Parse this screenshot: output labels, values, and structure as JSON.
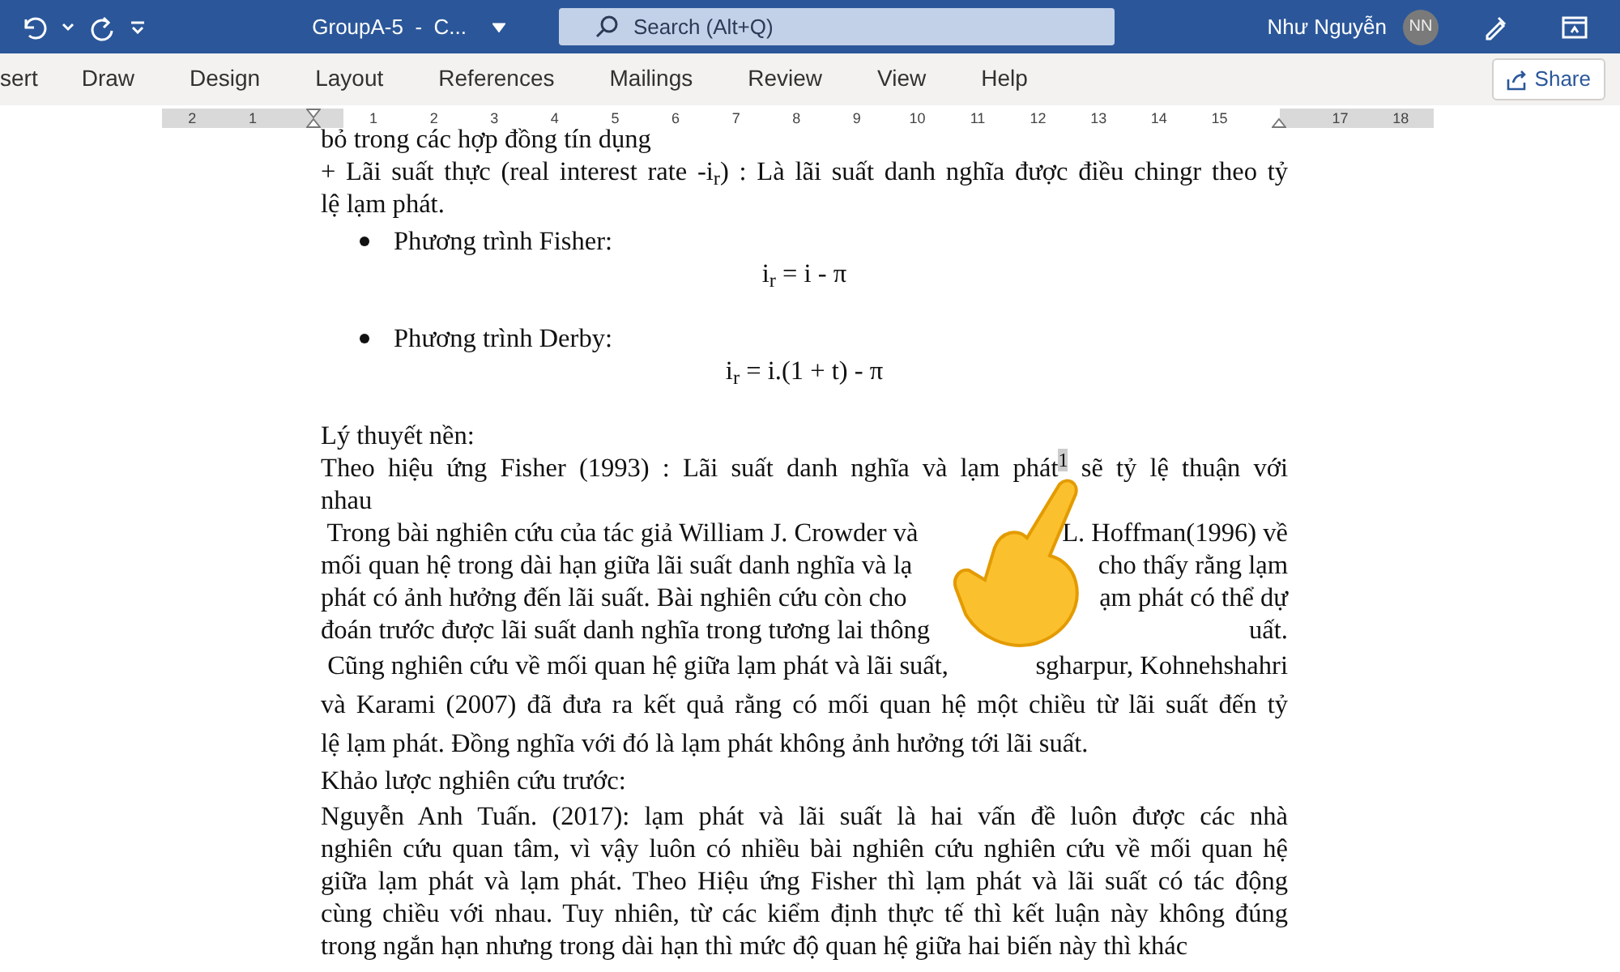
{
  "title_bar": {
    "document_title": "GroupA-5  -  C...",
    "search_placeholder": "Search (Alt+Q)",
    "user_name": "Như Nguyễn",
    "user_initials": "NN"
  },
  "ribbon": {
    "tabs": [
      {
        "label": "sert",
        "selected": false
      },
      {
        "label": "Draw",
        "selected": false
      },
      {
        "label": "Design",
        "selected": false
      },
      {
        "label": "Layout",
        "selected": false
      },
      {
        "label": "References",
        "selected": false
      },
      {
        "label": "Mailings",
        "selected": false
      },
      {
        "label": "Review",
        "selected": false
      },
      {
        "label": "View",
        "selected": false
      },
      {
        "label": "Help",
        "selected": false
      }
    ],
    "share_label": "Share"
  },
  "ruler": {
    "left_numbers": [
      "2",
      "1"
    ],
    "numbers": [
      "1",
      "2",
      "3",
      "4",
      "5",
      "6",
      "7",
      "8",
      "9",
      "10",
      "11",
      "12",
      "13",
      "14",
      "15"
    ],
    "right_numbers": [
      "17",
      "18"
    ]
  },
  "document": {
    "blocks": [
      {
        "kind": "paragraph",
        "lines": [
          {
            "text": "bỏ trong các hợp đồng tín dụng"
          }
        ]
      },
      {
        "kind": "paragraph",
        "lines": [
          {
            "text": "+ Lãi suất thực (real interest rate -i$_{r}$) : Là lãi suất danh nghĩa được điều chingr theo tỷ"
          },
          {
            "text": "lệ lạm phát."
          }
        ]
      },
      {
        "kind": "bullet",
        "lines": [
          {
            "text": "Phương trình Fisher:"
          }
        ]
      },
      {
        "kind": "formula",
        "lines": [
          {
            "text": "i$_{r}$ = i - π"
          }
        ]
      },
      {
        "kind": "bullet",
        "lines": [
          {
            "text": "Phương trình Derby:"
          }
        ]
      },
      {
        "kind": "formula",
        "lines": [
          {
            "text": "i$_{r}$ = i.(1 + t) - π"
          }
        ]
      },
      {
        "kind": "heading",
        "lines": [
          {
            "text": "Lý thuyết nền:"
          }
        ]
      },
      {
        "kind": "paragraph",
        "lines": [
          {
            "text": " Theo hiệu ứng Fisher (1993) : Lãi suất danh nghĩa và lạm phát$^{1}$ sẽ tỷ lệ thuận với"
          },
          {
            "text": "nhau"
          }
        ]
      },
      {
        "kind": "paragraph",
        "lines": [
          {
            "parts": [
              " Trong bài nghiên cứu của tác giả William J. Crowder và",
              "L. Hoffman(1996) về"
            ]
          },
          {
            "parts": [
              "mối quan hệ trong dài hạn giữa lãi suất danh nghĩa và lạ",
              "cho thấy rằng lạm"
            ]
          },
          {
            "parts": [
              "phát có ảnh hưởng đến lãi suất. Bài nghiên cứu còn cho",
              "ạm phát có thể dự"
            ]
          },
          {
            "parts": [
              "đoán trước được lãi suất danh nghĩa trong tương lai thông",
              "uất."
            ]
          }
        ]
      },
      {
        "kind": "paragraph-spaced",
        "lines": [
          {
            "parts": [
              " Cũng nghiên cứu về mối quan hệ giữa lạm phát và lãi suất,",
              "sgharpur, Kohnehshahri"
            ]
          },
          {
            "text": "và Karami (2007) đã đưa ra kết quả rằng có mối quan hệ một chiều từ lãi suất đến tỷ"
          },
          {
            "text": "lệ lạm phát. Đồng nghĩa với đó là lạm phát không ảnh hưởng tới lãi suất."
          }
        ]
      },
      {
        "kind": "heading-spaced",
        "lines": [
          {
            "text": "Khảo lược nghiên cứu trước:"
          }
        ]
      },
      {
        "kind": "paragraph-spaced-top",
        "lines": [
          {
            "text": "Nguyễn Anh Tuấn. (2017): lạm phát và lãi suất là hai vấn đề luôn được các nhà"
          },
          {
            "text": "nghiên cứu quan tâm, vì vậy luôn có nhiều bài nghiên cứu nghiên cứu về mối quan hệ"
          },
          {
            "text": "giữa lạm phát và lạm phát. Theo Hiệu ứng Fisher thì lạm phát và lãi suất có tác động"
          },
          {
            "text": "cùng chiều với nhau. Tuy nhiên, từ các kiểm định thực tế thì kết luận này không đúng"
          },
          {
            "text": "trong ngắn hạn nhưng trong dài hạn thì mức độ quan hệ giữa hai biến này thì khác"
          }
        ]
      }
    ]
  }
}
